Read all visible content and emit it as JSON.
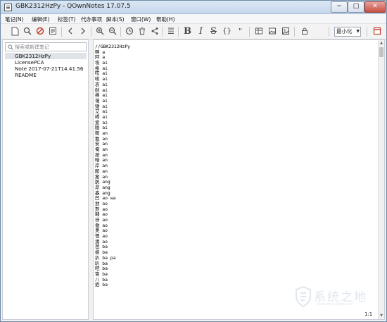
{
  "window": {
    "title": "GBK2312HzPy - QOwnNotes 17.07.5"
  },
  "titlebar_buttons": {
    "minimize": "−",
    "maximize": "□",
    "close": "✕"
  },
  "menu": [
    {
      "label": "笔记(N)"
    },
    {
      "label": "编辑(E)"
    },
    {
      "label": "标签(T)"
    },
    {
      "label": "代办事项"
    },
    {
      "label": "脚本(S)"
    },
    {
      "label": "窗口(W)"
    },
    {
      "label": "帮助(H)"
    }
  ],
  "toolbar": {
    "icons": [
      "new-note-icon",
      "find-icon",
      "remove-icon",
      "note-list-icon",
      "back-icon",
      "forward-icon",
      "zoom-in-icon",
      "zoom-out-icon",
      "clock-icon",
      "trash-icon",
      "share-icon",
      "format-icon",
      "bold-icon",
      "italic-icon",
      "strikethrough-icon",
      "code-block-icon",
      "quote-icon",
      "table-icon",
      "image-icon",
      "insert-image-icon",
      "lock-icon",
      "close-app-icon"
    ],
    "bold": "B",
    "italic": "I",
    "strike": "S",
    "code": "{}",
    "quote": "\"",
    "zoom_value": "最小化"
  },
  "sidebar": {
    "search_placeholder": "搜索或新建笔记",
    "notes": [
      {
        "title": "GBK2312HzPy",
        "selected": true
      },
      {
        "title": "LicensePCA",
        "selected": false
      },
      {
        "title": "Note 2017-07-21T14.41.56",
        "selected": false
      },
      {
        "title": "README",
        "selected": false
      }
    ]
  },
  "editor": {
    "lines": [
      "//GBK2312HzPy",
      "啊 a",
      "阿 a",
      "埃 ai",
      "挨 ai",
      "哎 ai",
      "唉 ai",
      "哀 ai",
      "皑 ai",
      "癌 ai",
      "蔼 ai",
      "矮 ai",
      "艾 ai",
      "碍 ai",
      "爱 ai",
      "隘 ai",
      "鞍 an",
      "氨 an",
      "安 an",
      "俺 an",
      "按 an",
      "暗 an",
      "岸 an",
      "胺 an",
      "案 an",
      "肮 ang",
      "昂 ang",
      "盎 ang",
      "凹 ao wa",
      "敖 ao",
      "熬 ao",
      "翱 ao",
      "袄 ao",
      "傲 ao",
      "奥 ao",
      "懊 ao",
      "澳 ao",
      "芭 ba",
      "捌 ba",
      "扒 ba pa",
      "叭 ba",
      "吧 ba",
      "笆 ba",
      "八 ba",
      "疤 ba"
    ]
  },
  "status": {
    "cursor_position": "1:1"
  },
  "watermark": {
    "text": "系统之地",
    "sub": "www.xitongzhijia.net"
  }
}
